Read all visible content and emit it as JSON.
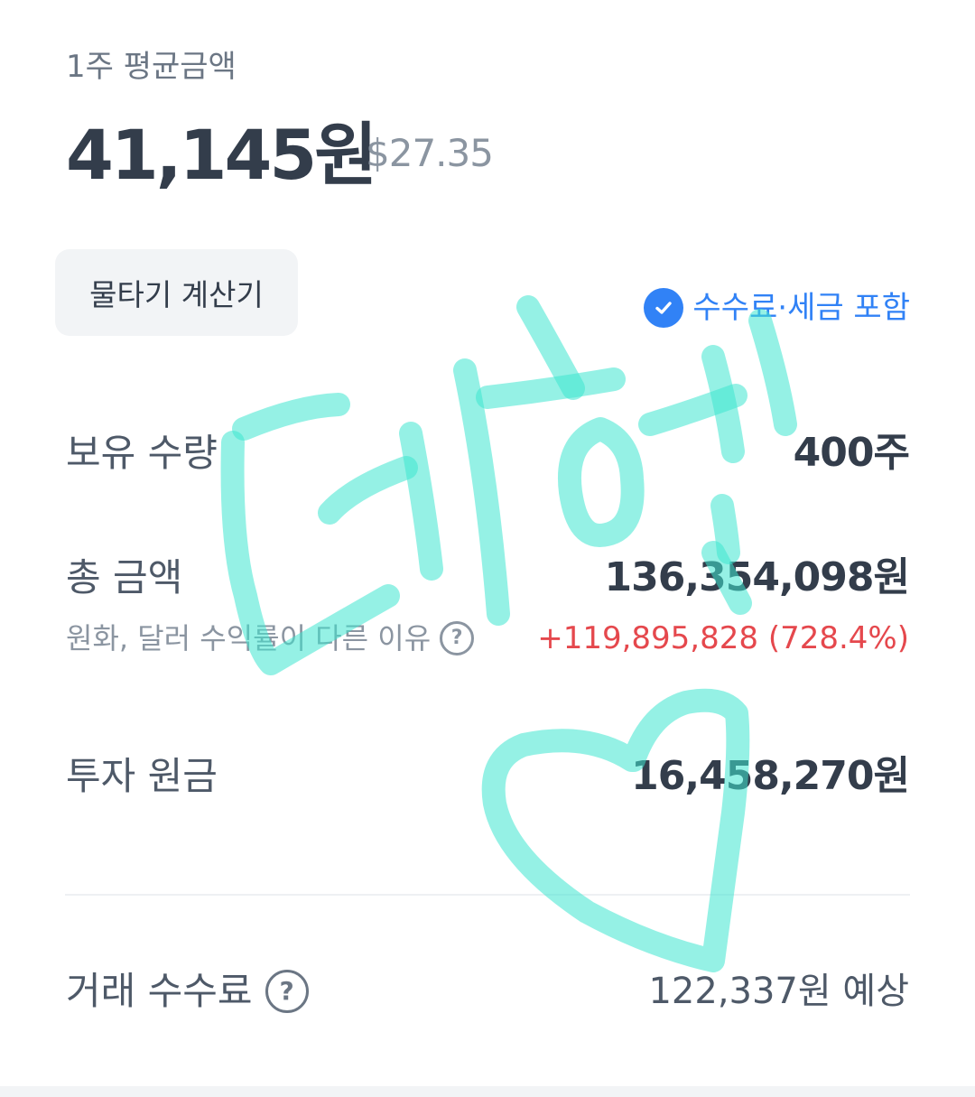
{
  "average": {
    "label": "1주 평균금액",
    "krw": "41,145원",
    "usd": "$27.35"
  },
  "calculator_button": "물타기 계산기",
  "fee_badge": {
    "text": "수수료·세금 포함",
    "icon": "check-circle-icon",
    "color": "#3182f6"
  },
  "holdings": {
    "label": "보유 수량",
    "value": "400주"
  },
  "total": {
    "label": "총 금액",
    "value": "136,354,098원",
    "sub_label": "원화, 달러 수익률이 다른 이유",
    "profit": "+119,895,828 (728.4%)",
    "profit_color": "#e5484d"
  },
  "principal": {
    "label": "투자 원금",
    "value": "16,458,270원"
  },
  "trading_fee": {
    "label": "거래 수수료",
    "value": "122,337원 예상"
  },
  "help_icon": "?",
  "overlay": {
    "description": "handwritten teal scribble and heart drawn over the screen",
    "color": "#3ee6d0"
  }
}
